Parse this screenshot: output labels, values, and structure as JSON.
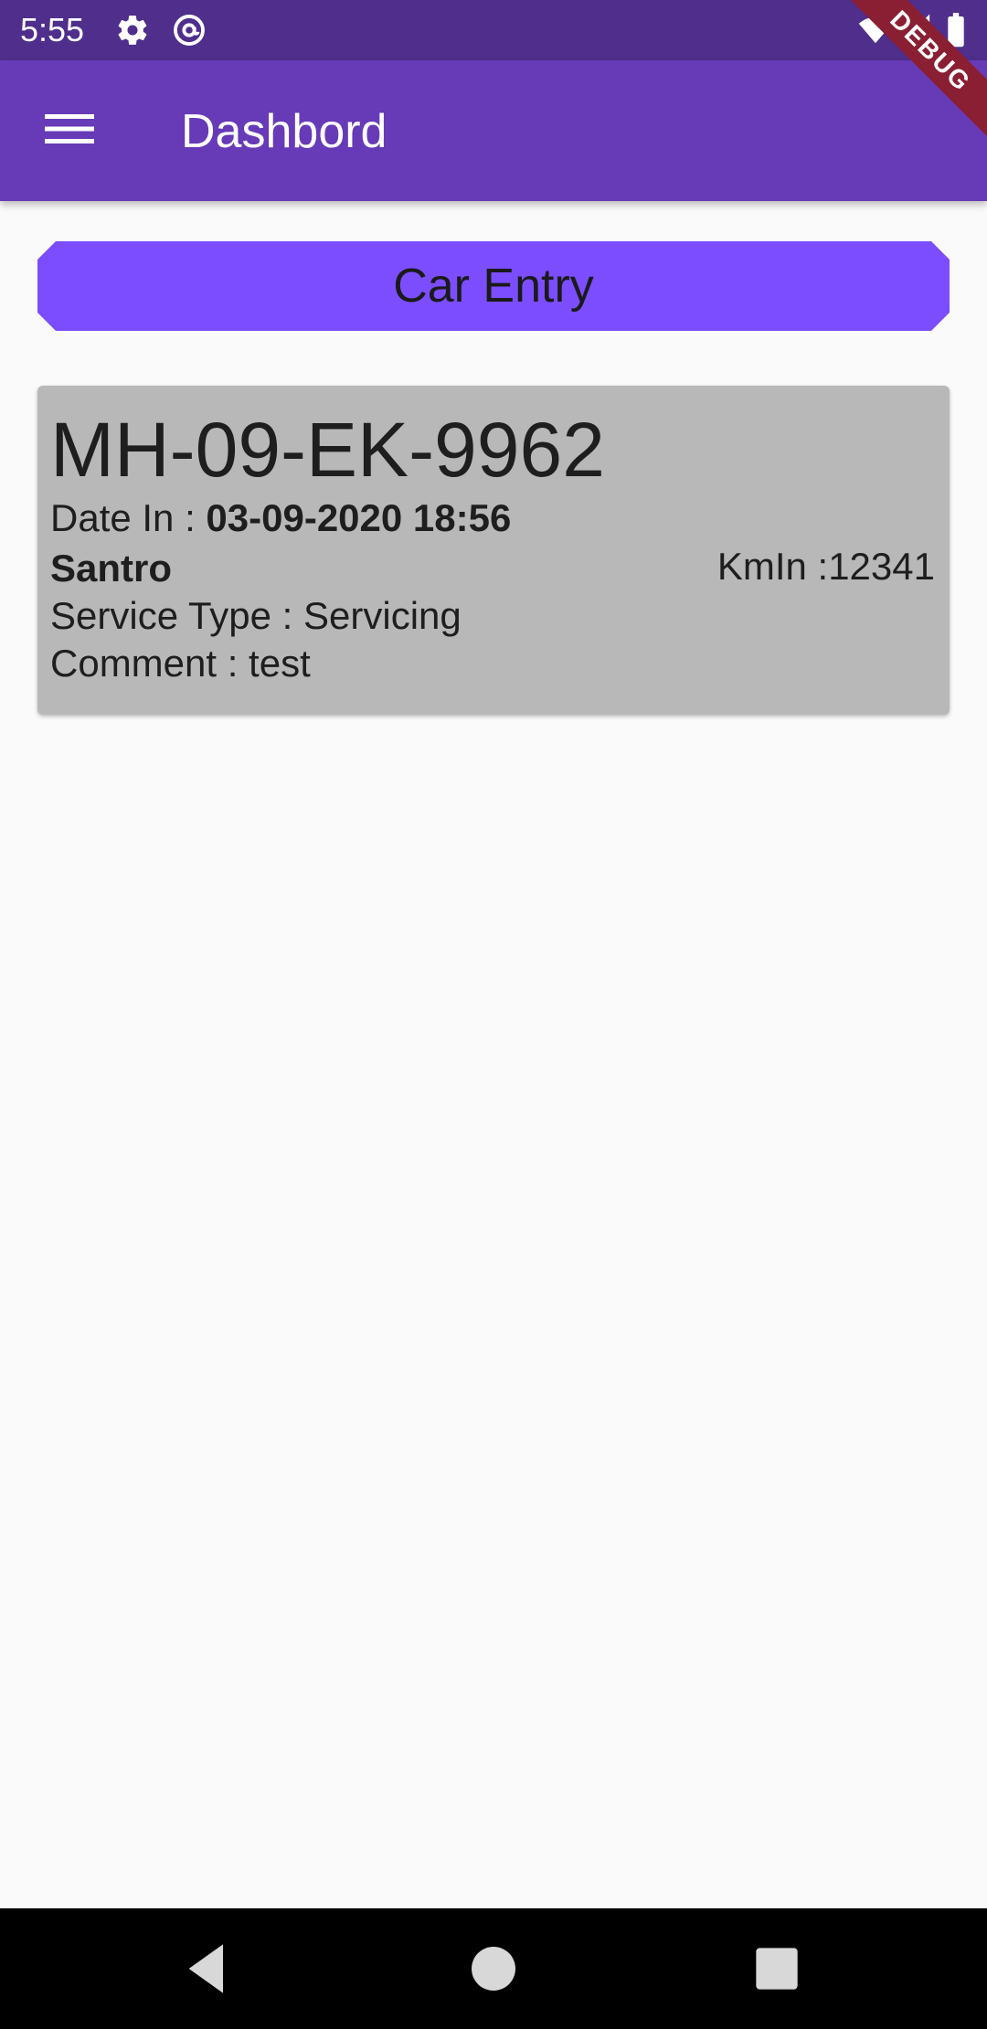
{
  "status_bar": {
    "time": "5:55",
    "icons": [
      "gear-icon",
      "at-sign-icon",
      "wifi-icon",
      "cell-signal-icon",
      "battery-icon"
    ]
  },
  "debug_banner": "DEBUG",
  "app_bar": {
    "title": "Dashbord",
    "menu_icon": "hamburger-menu-icon"
  },
  "car_entry_button": {
    "label": "Car Entry"
  },
  "entry": {
    "plate": "MH-09-EK-9962",
    "date_label": "Date In : ",
    "date_value": "03-09-2020 18:56",
    "model": "Santro",
    "km_in": "KmIn :12341",
    "service_type": "Service Type : Servicing",
    "comment": "Comment : test"
  },
  "nav_bar": {
    "icons": [
      "back-icon",
      "home-icon",
      "recents-icon"
    ]
  },
  "colors": {
    "status_bar": "#4f2e8c",
    "app_bar": "#673ab7",
    "button": "#7c4dff",
    "card": "#b8b8b8",
    "background": "#fafafa",
    "debug_banner": "#8a1f34"
  }
}
